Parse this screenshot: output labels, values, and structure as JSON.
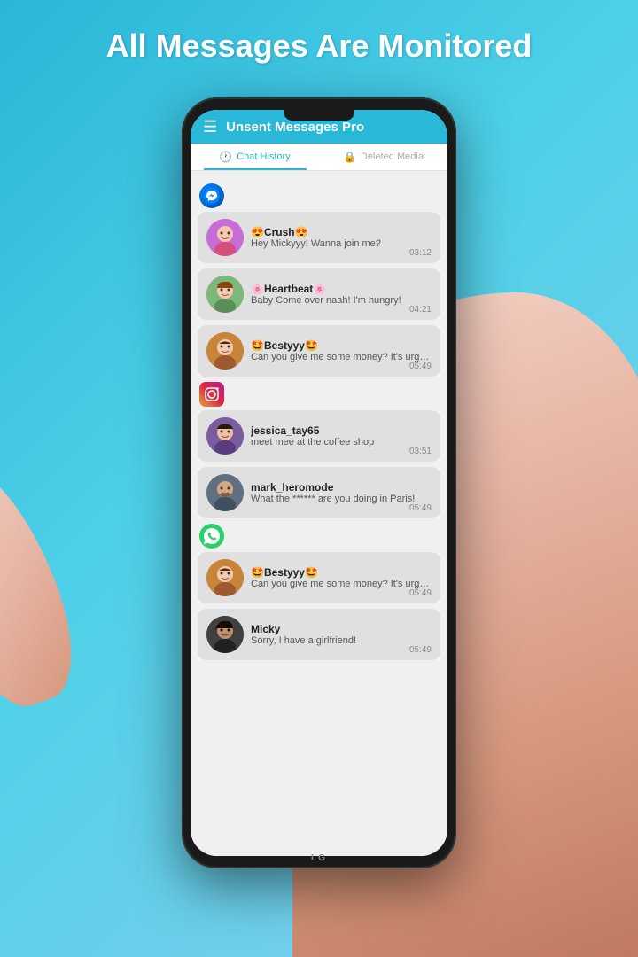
{
  "headline": "All Messages Are Monitored",
  "app": {
    "title": "Unsent Messages Pro",
    "tabs": [
      {
        "label": "Chat History",
        "active": true
      },
      {
        "label": "Deleted Media",
        "active": false
      }
    ]
  },
  "sections": [
    {
      "platform": "messenger",
      "platform_icon": "💬",
      "messages": [
        {
          "sender": "😍Crush😍",
          "text": "Hey Mickyyy! Wanna join me?",
          "time": "03:12",
          "avatar_emoji": "👩"
        },
        {
          "sender": "🌸Heartbeat🌸",
          "text": "Baby Come over naah! I'm hungry!",
          "time": "04:21",
          "avatar_emoji": "👩‍🦰"
        },
        {
          "sender": "🤩Bestyyy🤩",
          "text": "Can you give me some money? It's urgent",
          "time": "05:49",
          "avatar_emoji": "👩‍🦱"
        }
      ]
    },
    {
      "platform": "instagram",
      "platform_icon": "📷",
      "messages": [
        {
          "sender": "jessica_tay65",
          "text": "meet mee at the coffee shop",
          "time": "03:51",
          "avatar_emoji": "👩‍💼"
        },
        {
          "sender": "mark_heromode",
          "text": "What the ****** are you doing in Paris!",
          "time": "05:49",
          "avatar_emoji": "🧔"
        }
      ]
    },
    {
      "platform": "whatsapp",
      "platform_icon": "📱",
      "messages": [
        {
          "sender": "🤩Bestyyy🤩",
          "text": "Can you give me some money? It's urgent",
          "time": "05:49",
          "avatar_emoji": "👩‍🦱"
        },
        {
          "sender": "Micky",
          "text": "Sorry, I have a girlfriend!",
          "time": "05:49",
          "avatar_emoji": "🧑‍🦱"
        }
      ]
    }
  ],
  "colors": {
    "accent": "#29b8d8",
    "background_gradient_start": "#29b6d8",
    "background_gradient_end": "#87ceeb",
    "card_bg": "#e0e0e0"
  }
}
